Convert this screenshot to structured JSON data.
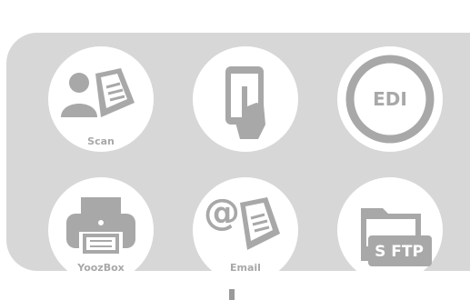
{
  "tiles": {
    "scan": {
      "label": "Scan"
    },
    "mobile": {
      "label": ""
    },
    "edi": {
      "label": "EDI"
    },
    "yoozbox": {
      "label": "YoozBox"
    },
    "email": {
      "label": "Email"
    },
    "sftp": {
      "label": "S FTP"
    }
  },
  "colors": {
    "panel": "#d7d7d7",
    "tile": "#ffffff",
    "icon": "#a8a8a8",
    "stem": "#9a9a9a"
  },
  "icons": [
    "scan-document-icon",
    "tablet-touch-icon",
    "edi-ring-icon",
    "printer-icon",
    "email-document-icon",
    "folder-sftp-icon"
  ]
}
